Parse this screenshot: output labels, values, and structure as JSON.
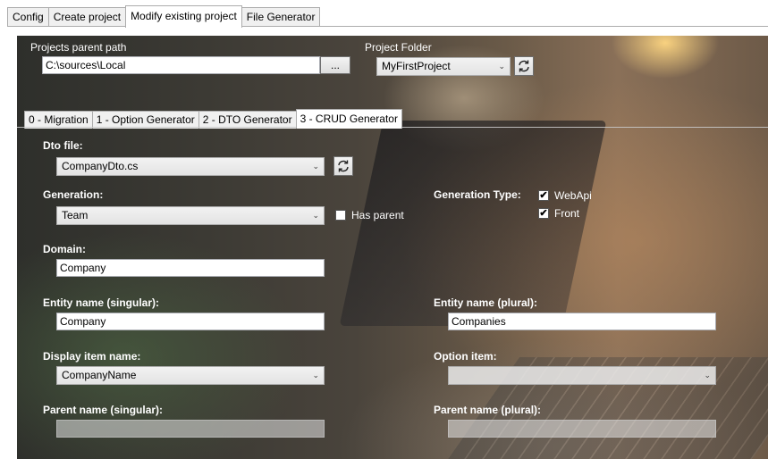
{
  "top_tabs": [
    {
      "label": "Config",
      "active": false
    },
    {
      "label": "Create project",
      "active": false
    },
    {
      "label": "Modify existing project",
      "active": true
    },
    {
      "label": "File Generator",
      "active": false
    }
  ],
  "header": {
    "parent_path_label": "Projects parent path",
    "parent_path_value": "C:\\sources\\Local",
    "browse_label": "...",
    "project_folder_label": "Project Folder",
    "project_folder_value": "MyFirstProject",
    "refresh_icon": "refresh-icon"
  },
  "inner_tabs": [
    {
      "label": "0 - Migration",
      "active": false
    },
    {
      "label": "1 - Option Generator",
      "active": false
    },
    {
      "label": "2 - DTO Generator",
      "active": false
    },
    {
      "label": "3 - CRUD Generator",
      "active": true
    }
  ],
  "crud": {
    "dto_file_label": "Dto file:",
    "dto_file_value": "CompanyDto.cs",
    "generation_label": "Generation:",
    "generation_value": "Team",
    "has_parent_label": "Has parent",
    "has_parent_checked": false,
    "generation_type_label": "Generation Type:",
    "webapi_label": "WebApi",
    "webapi_checked": true,
    "front_label": "Front",
    "front_checked": true,
    "domain_label": "Domain:",
    "domain_value": "Company",
    "entity_singular_label": "Entity name (singular):",
    "entity_singular_value": "Company",
    "entity_plural_label": "Entity name (plural):",
    "entity_plural_value": "Companies",
    "display_item_label": "Display item name:",
    "display_item_value": "CompanyName",
    "option_item_label": "Option item:",
    "option_item_value": "",
    "parent_singular_label": "Parent name (singular):",
    "parent_singular_value": "",
    "parent_plural_label": "Parent name (plural):",
    "parent_plural_value": ""
  },
  "check_mark": "✔",
  "dropdown_arrow": "⌄"
}
